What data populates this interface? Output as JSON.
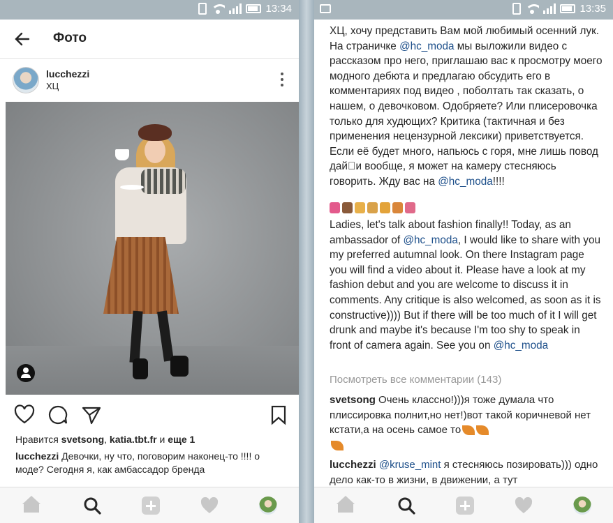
{
  "left": {
    "status": {
      "time": "13:34"
    },
    "appbar": {
      "title": "Фото"
    },
    "post": {
      "username": "lucchezzi",
      "location": "ХЦ"
    },
    "likes": {
      "prefix": "Нравится ",
      "user1": "svetsong",
      "sep": ", ",
      "user2": "katia.tbt.fr",
      "and": " и ",
      "more": "еще 1"
    },
    "caption": {
      "author": "lucchezzi",
      "text": " Девочки, ну что, поговорим  наконец-то !!!! о моде?  Сегодня я, как амбассадор бренда"
    },
    "nav": [
      "home-icon",
      "search-icon",
      "add-icon",
      "heart-icon",
      "profile-avatar"
    ]
  },
  "right": {
    "status": {
      "time": "13:35"
    },
    "ru_part1": "ХЦ, хочу представить Вам мой любимый осенний лук. На страничке ",
    "ru_mention1": "@hc_moda",
    "ru_part2": "  мы выложили видео с рассказом про него, приглашаю вас к просмотру моего модного дебюта и предлагаю обсудить  его в комментариях под видео , поболтать так сказать, о нашем, о девочковом. Одобряете? Или плисеровочка только для худющих?  Критика (тактичная и без применения нецензурной лексики) приветствуется. Если её будет много, напьюсь с горя, мне лишь повод дай⃞и вообще, я может на камеру стесняюсь говорить. Жду вас на ",
    "ru_mention2": "@hc_moda",
    "ru_part3": "!!!!",
    "en_part1": "Ladies, let's talk about fashion finally!! Today, as an ambassador of ",
    "en_mention1": "@hc_moda",
    "en_part2": ", I would like to share with you my preferred autumnal look. On there Instagram page you will find a video about it. Please have a look at my fashion debut and you are welcome to discuss it in comments. Any critique is also welcomed, as soon as it is constructive)))) But if there will be too much of it I will get drunk and maybe it's because I'm too shy to speak in front of camera again. See you on ",
    "en_mention2": "@hc_moda",
    "view_all": "Посмотреть все комментарии (143)",
    "comment1": {
      "author": "svetsong",
      "text": " Очень классно!)))я тоже думала что плиссировка полнит,но нет!)вот такой коричневой нет кстати,а на осень самое то"
    },
    "comment2": {
      "author": "lucchezzi",
      "mention": "@kruse_mint",
      "text": " я стесняюсь позировать))) одно дело как-то в жизни, в движении, а тут"
    },
    "emoji_colors": [
      "#e35a8c",
      "#8a5a3a",
      "#e8b04a",
      "#d9a24a",
      "#e3a33a",
      "#d9863a",
      "#e06a8a"
    ],
    "nav": [
      "home-icon",
      "search-icon",
      "add-icon",
      "heart-icon",
      "profile-avatar"
    ]
  }
}
